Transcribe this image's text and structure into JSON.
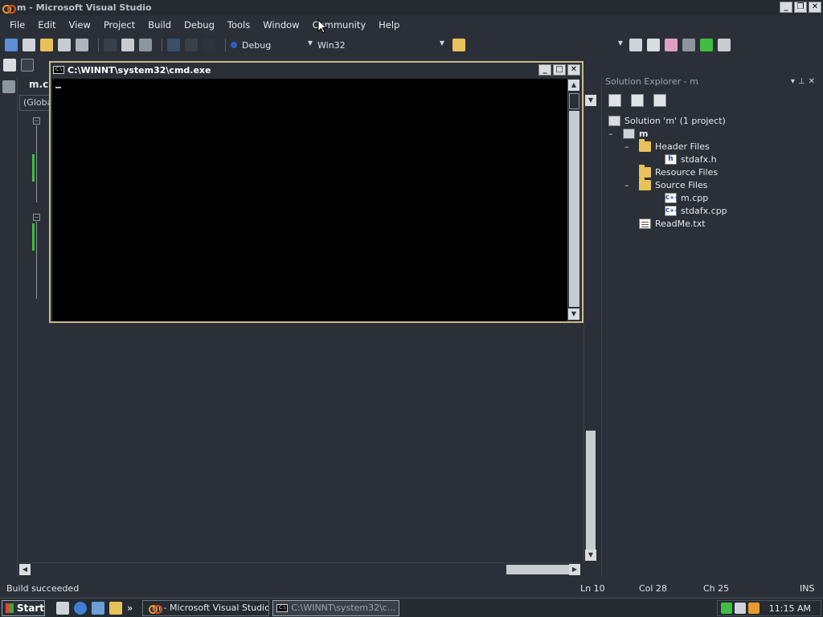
{
  "window": {
    "title": "m - Microsoft Visual Studio"
  },
  "menu": [
    "File",
    "Edit",
    "View",
    "Project",
    "Build",
    "Debug",
    "Tools",
    "Window",
    "Community",
    "Help"
  ],
  "toolbar": {
    "config": "Debug",
    "platform": "Win32"
  },
  "editor": {
    "tab_label": "m.c",
    "scope_label": "(Globa"
  },
  "cmd": {
    "title": "C:\\WINNT\\system32\\cmd.exe",
    "icon_text": "C:\\"
  },
  "solution_explorer": {
    "title": "Solution Explorer - m",
    "tree": [
      {
        "label": "Solution 'm' (1 project)",
        "icon": "solution-icon",
        "depth": 0,
        "expander": ""
      },
      {
        "label": "m",
        "icon": "project-icon",
        "depth": 1,
        "expander": "–",
        "bold": true
      },
      {
        "label": "Header Files",
        "icon": "folder-icon",
        "depth": 2,
        "expander": "–"
      },
      {
        "label": "stdafx.h",
        "icon": "header-file-icon",
        "depth": 3,
        "expander": ""
      },
      {
        "label": "Resource Files",
        "icon": "folder-icon",
        "depth": 2,
        "expander": ""
      },
      {
        "label": "Source Files",
        "icon": "folder-icon",
        "depth": 2,
        "expander": "–"
      },
      {
        "label": "m.cpp",
        "icon": "cpp-file-icon",
        "depth": 3,
        "expander": ""
      },
      {
        "label": "stdafx.cpp",
        "icon": "cpp-file-icon",
        "depth": 3,
        "expander": ""
      },
      {
        "label": "ReadMe.txt",
        "icon": "text-file-icon",
        "depth": 2,
        "expander": ""
      }
    ]
  },
  "status": {
    "message": "Build succeeded",
    "line": "Ln 10",
    "col": "Col 28",
    "ch": "Ch 25",
    "mode": "INS"
  },
  "taskbar": {
    "start": "Start",
    "tasks": [
      {
        "label": "m - Microsoft Visual Studio",
        "active": false
      },
      {
        "label": "C:\\WINNT\\system32\\c...",
        "active": true
      }
    ],
    "chevron": "»",
    "clock": "11:15 AM"
  },
  "colors": {
    "background": "#2b3038",
    "cmd_border": "#c9b98a",
    "folder": "#e8c15a",
    "change_marker": "#3fbf3f"
  }
}
